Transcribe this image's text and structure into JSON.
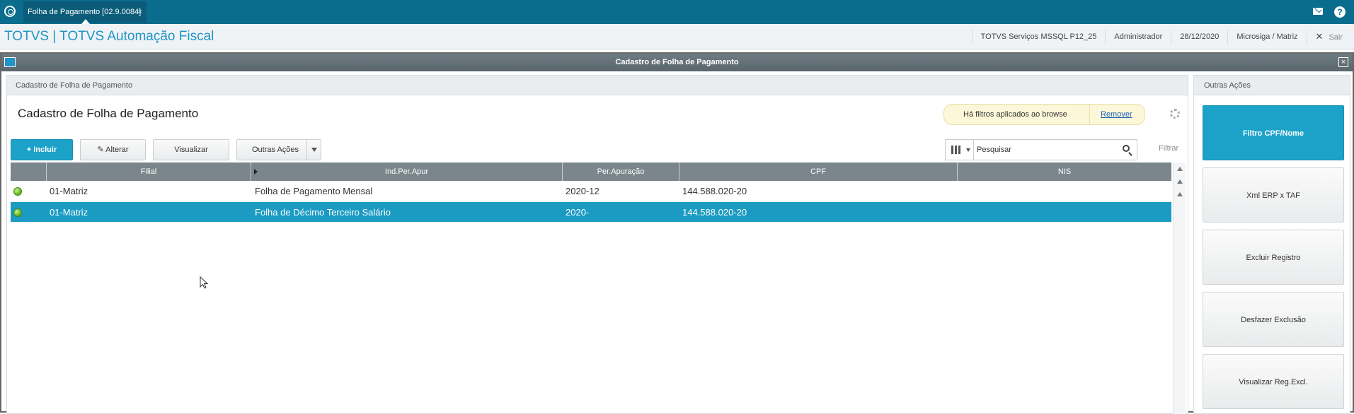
{
  "tab": {
    "title": "Folha de Pagamento [02.9.0084]",
    "close": "×"
  },
  "app": {
    "title": "TOTVS | TOTVS Automação Fiscal",
    "server": "TOTVS Serviços MSSQL P12_25",
    "user": "Administrador",
    "date": "28/12/2020",
    "company": "Microsiga / Matriz",
    "logout_icon": "✕",
    "logout": "Sair"
  },
  "window": {
    "title": "Cadastro de Folha de Pagamento",
    "close": "×"
  },
  "main": {
    "breadcrumb": "Cadastro de Folha de Pagamento",
    "title": "Cadastro de Folha de Pagamento",
    "filter_notice": "Há filtros aplicados ao browse",
    "filter_remove": "Remover",
    "buttons": {
      "incluir": "Incluir",
      "alterar": "Alterar",
      "visualizar": "Visualizar",
      "outras": "Outras Ações"
    },
    "search": {
      "value": "Pesquisar",
      "filter_label": "Filtrar"
    },
    "columns": [
      "Filial",
      "Ind.Per.Apur",
      "Per.Apuração",
      "CPF",
      "NIS"
    ],
    "rows": [
      {
        "status": "green",
        "filial": "01-Matriz",
        "ind": "Folha de Pagamento Mensal",
        "per": "2020-12",
        "cpf": "144.588.020-20",
        "nis": ""
      },
      {
        "status": "green",
        "filial": "01-Matriz",
        "ind": "Folha de Décimo Terceiro Salário",
        "per": "2020-",
        "cpf": "144.588.020-20",
        "nis": ""
      }
    ]
  },
  "side": {
    "title": "Outras Ações",
    "buttons": [
      "Filtro CPF/Nome",
      "Xml ERP x TAF",
      "Excluir Registro",
      "Desfazer Exclusão",
      "Visualizar Reg.Excl."
    ]
  },
  "colors": {
    "topbar": "#0b6d8e",
    "accent": "#1ca2c9",
    "selected_row": "#1b9bc2",
    "header": "#7b868c"
  }
}
